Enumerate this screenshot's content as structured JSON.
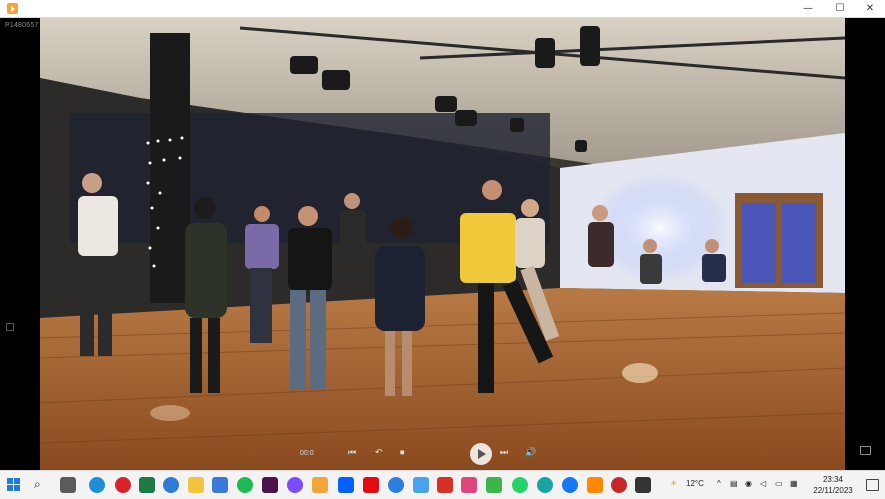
{
  "window": {
    "minimize_glyph": "—",
    "maximize_glyph": "☐",
    "close_glyph": "✕"
  },
  "player": {
    "file_name": "P1480657",
    "time": "00:0",
    "controls": [
      "⏮",
      "↶",
      "⏹",
      "▶",
      "⏭",
      "🔊"
    ]
  },
  "taskbar": {
    "weather": "12°C",
    "time": "23:34",
    "date": "22/11/2023",
    "icons": [
      "search-icon",
      "task-view-icon",
      "edge-icon",
      "pinterest-icon",
      "excel-icon",
      "teams-icon",
      "file-explorer-icon",
      "store-icon",
      "spotify-icon",
      "slack-icon",
      "photos-icon",
      "media-player-icon",
      "dropbox-icon",
      "netflix-icon",
      "onedrive-icon",
      "paint-icon",
      "gmail-icon",
      "sway-icon",
      "facetime-icon",
      "whatsapp-icon",
      "edge-dev-icon",
      "facebook-icon",
      "vlc-icon",
      "record-icon",
      "chat-icon"
    ]
  },
  "colors": {
    "taskbar_bg": "#f3f3f3",
    "accent": "#1f7ae0",
    "floor": "#a8622c"
  }
}
